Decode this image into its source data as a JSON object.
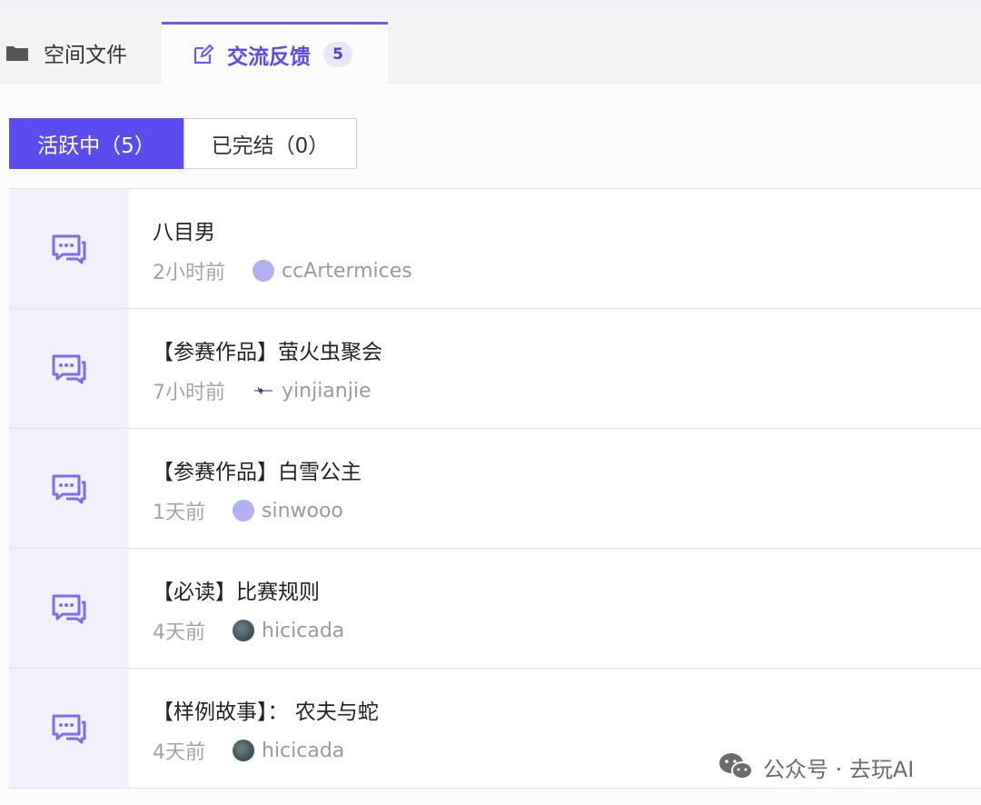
{
  "tabs": {
    "files_label": "空间文件",
    "feedback_label": "交流反馈",
    "feedback_badge": "5"
  },
  "filter": {
    "active_label": "活跃中（5）",
    "done_label": "已完结（0）"
  },
  "posts": [
    {
      "title": "八目男",
      "time": "2小时前",
      "user": "ccArtermices",
      "avatar": "gradient"
    },
    {
      "title": "【参赛作品】萤火虫聚会",
      "time": "7小时前",
      "user": "yinjianjie",
      "avatar": "line"
    },
    {
      "title": "【参赛作品】白雪公主",
      "time": "1天前",
      "user": "sinwooo",
      "avatar": "gradient"
    },
    {
      "title": "【必读】比赛规则",
      "time": "4天前",
      "user": "hicicada",
      "avatar": "dark"
    },
    {
      "title": "【样例故事】： 农夫与蛇",
      "time": "4天前",
      "user": "hicicada",
      "avatar": "dark"
    }
  ],
  "watermark": {
    "text": "公众号 · 去玩AI"
  },
  "colors": {
    "accent": "#5b4cf0",
    "icon_tint": "#7b6cf0"
  }
}
